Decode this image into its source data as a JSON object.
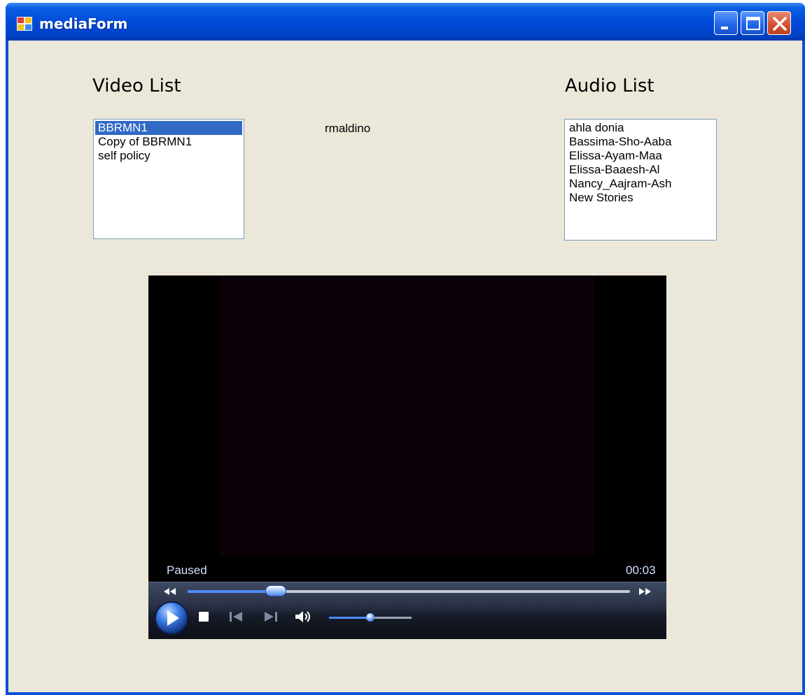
{
  "window": {
    "title": "mediaForm",
    "colors": {
      "titlebar": "#0048d8",
      "client": "#ebe8d9",
      "selection": "#316ac5"
    }
  },
  "video_section": {
    "title": "Video List",
    "items": [
      {
        "label": "BBRMN1",
        "selected": true
      },
      {
        "label": "Copy of BBRMN1",
        "selected": false
      },
      {
        "label": "self policy",
        "selected": false
      }
    ]
  },
  "center_label": "rmaldino",
  "audio_section": {
    "title": "Audio List",
    "items": [
      {
        "label": "ahla donia"
      },
      {
        "label": "Bassima-Sho-Aaba"
      },
      {
        "label": "Elissa-Ayam-Maa"
      },
      {
        "label": "Elissa-Baaesh-Al"
      },
      {
        "label": "Nancy_Aajram-Ash"
      },
      {
        "label": "New Stories"
      }
    ]
  },
  "player": {
    "status": "Paused",
    "time": "00:03",
    "seek_progress": 0.2,
    "volume_level": 0.5,
    "icons": [
      "play-icon",
      "stop-icon",
      "previous-icon",
      "next-icon",
      "volume-icon",
      "rewind-icon",
      "fast-forward-icon"
    ]
  }
}
